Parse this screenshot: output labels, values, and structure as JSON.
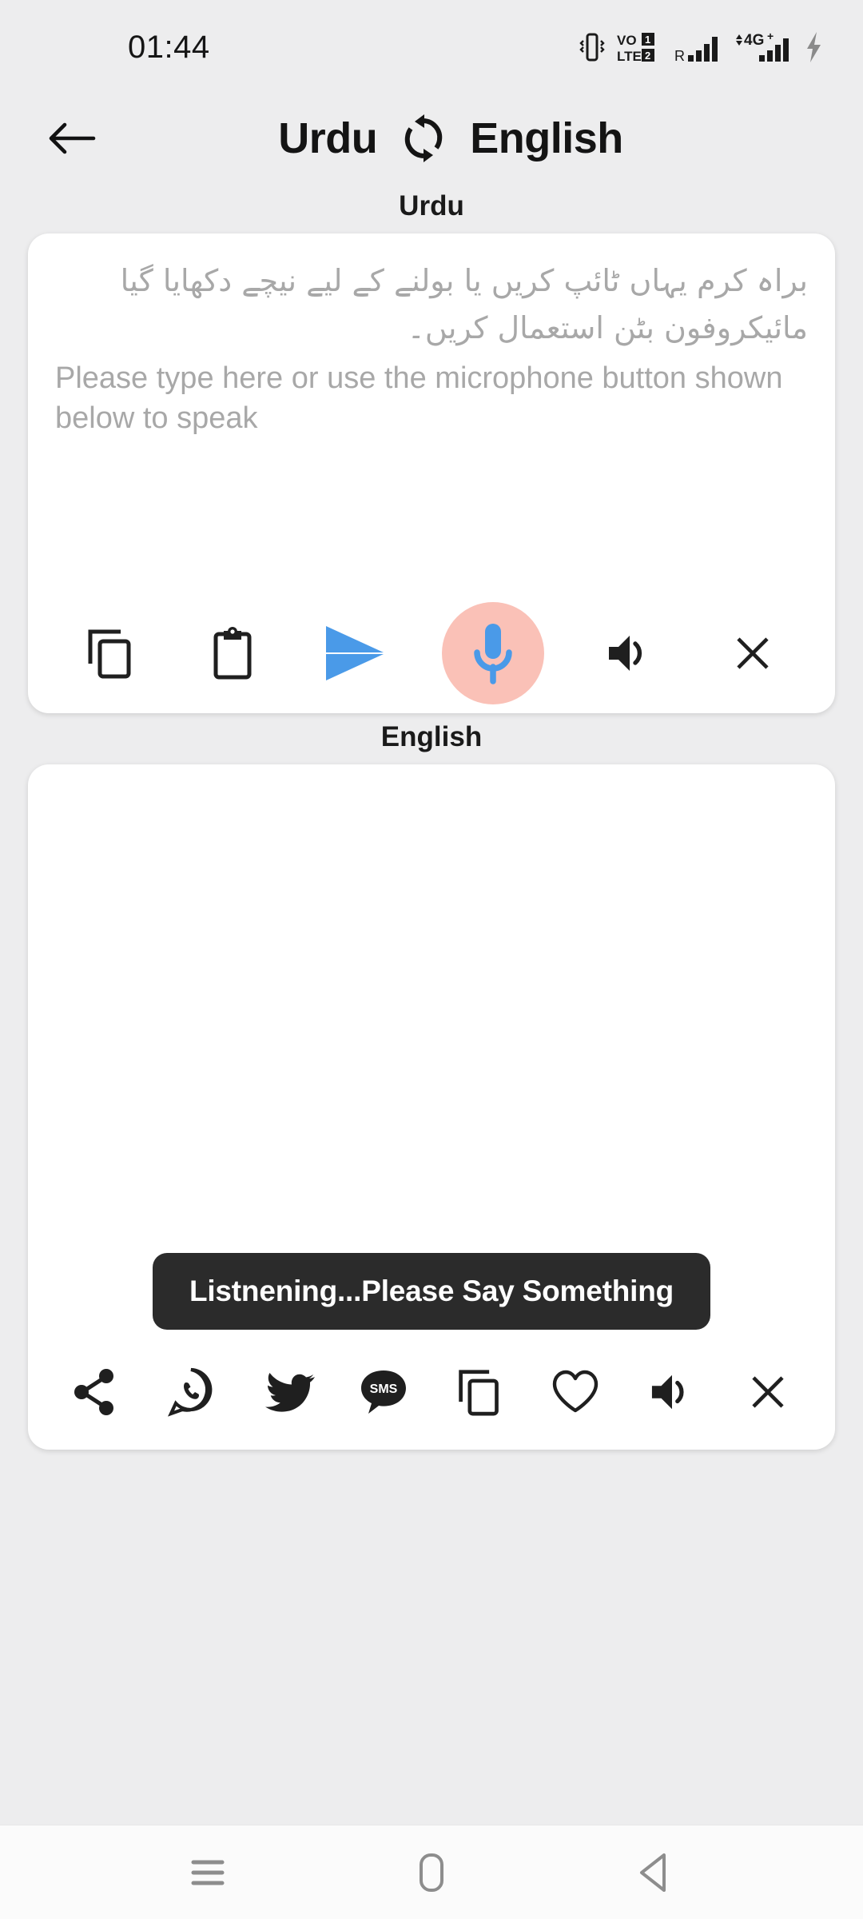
{
  "status_bar": {
    "time": "01:44",
    "icons": [
      "vibrate-icon",
      "volte-dual-sim-icon",
      "roaming-signal-icon",
      "4g-plus-signal-icon",
      "charging-bolt-icon"
    ]
  },
  "header": {
    "back_icon": "back-arrow-icon",
    "source_language": "Urdu",
    "swap_icon": "swap-languages-icon",
    "target_language": "English"
  },
  "input_section": {
    "label": "Urdu",
    "placeholder_urdu": "براہ کرم یہاں ٹائپ کریں یا بولنے کے لیے نیچے دکھایا گیا مائیکروفون بٹن استعمال کریں۔",
    "placeholder_english": "Please type here or use the microphone button shown below to speak",
    "value": "",
    "toolbar": [
      {
        "name": "copy-button",
        "icon": "copy-icon",
        "label": "Copy"
      },
      {
        "name": "paste-button",
        "icon": "clipboard-icon",
        "label": "Paste"
      },
      {
        "name": "translate-send-button",
        "icon": "send-arrow-icon",
        "label": "Translate"
      },
      {
        "name": "microphone-button",
        "icon": "microphone-icon",
        "label": "Speak"
      },
      {
        "name": "speak-text-button",
        "icon": "speaker-icon",
        "label": "Listen"
      },
      {
        "name": "clear-input-button",
        "icon": "close-x-icon",
        "label": "Clear"
      }
    ]
  },
  "output_section": {
    "label": "English",
    "value": "",
    "toolbar": [
      {
        "name": "share-button",
        "icon": "share-icon",
        "label": "Share"
      },
      {
        "name": "whatsapp-button",
        "icon": "whatsapp-icon",
        "label": "WhatsApp"
      },
      {
        "name": "twitter-button",
        "icon": "twitter-icon",
        "label": "Twitter"
      },
      {
        "name": "sms-button",
        "icon": "sms-icon",
        "label": "SMS"
      },
      {
        "name": "copy-output-button",
        "icon": "copy-icon",
        "label": "Copy"
      },
      {
        "name": "favorite-button",
        "icon": "heart-icon",
        "label": "Favorite"
      },
      {
        "name": "speak-output-button",
        "icon": "speaker-icon",
        "label": "Listen"
      },
      {
        "name": "clear-output-button",
        "icon": "close-x-icon",
        "label": "Clear"
      }
    ]
  },
  "toast": {
    "message": "Listnening...Please Say Something"
  },
  "nav_bar": {
    "recents_label": "Recents",
    "home_label": "Home",
    "back_label": "Back"
  },
  "colors": {
    "background": "#ededee",
    "card": "#ffffff",
    "accent_blue": "#4a9ae8",
    "mic_circle_pink": "#fac1b7",
    "toast_bg": "#2b2b2b",
    "placeholder_text": "#a8a8a8",
    "icon_dark": "#1f1f1f",
    "nav_icon": "#8d8d8d"
  }
}
